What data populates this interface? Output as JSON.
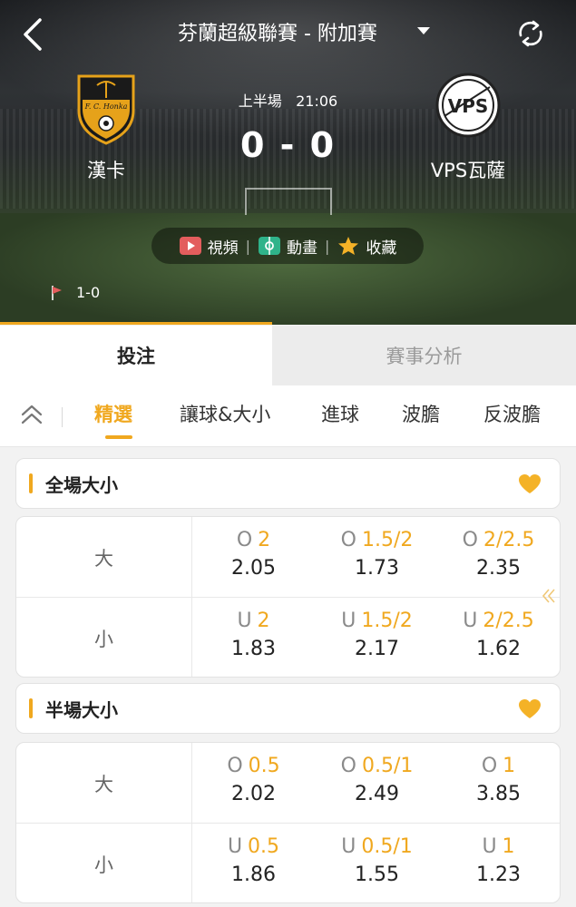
{
  "header": {
    "title": "芬蘭超級聯賽 - 附加賽",
    "back_icon": "chevron-left-icon",
    "refresh_icon": "refresh-icon"
  },
  "match": {
    "home_team": "漢卡",
    "away_team": "VPS瓦薩",
    "period": "上半場",
    "clock": "21:06",
    "score": "0 - 0",
    "home_crest_text": "F. C. Honka",
    "away_crest_text": "VPS",
    "corners": "1-0"
  },
  "actions": [
    {
      "label": "視頻",
      "icon": "video-icon"
    },
    {
      "label": "動畫",
      "icon": "animation-icon"
    },
    {
      "label": "收藏",
      "icon": "star-icon"
    }
  ],
  "main_tabs": [
    {
      "label": "投注",
      "active": true
    },
    {
      "label": "賽事分析",
      "active": false
    }
  ],
  "sub_tabs": [
    {
      "label": "精選",
      "active": true
    },
    {
      "label": "讓球&大小",
      "active": false
    },
    {
      "label": "進球",
      "active": false
    },
    {
      "label": "波膽",
      "active": false
    },
    {
      "label": "反波膽",
      "active": false
    }
  ],
  "sections": [
    {
      "title": "全場大小",
      "rows": [
        {
          "label": "大",
          "cells": [
            {
              "side": "O",
              "line": "2",
              "odds": "2.05"
            },
            {
              "side": "O",
              "line": "1.5/2",
              "odds": "1.73"
            },
            {
              "side": "O",
              "line": "2/2.5",
              "odds": "2.35"
            }
          ]
        },
        {
          "label": "小",
          "cells": [
            {
              "side": "U",
              "line": "2",
              "odds": "1.83"
            },
            {
              "side": "U",
              "line": "1.5/2",
              "odds": "2.17"
            },
            {
              "side": "U",
              "line": "2/2.5",
              "odds": "1.62"
            }
          ]
        }
      ]
    },
    {
      "title": "半場大小",
      "rows": [
        {
          "label": "大",
          "cells": [
            {
              "side": "O",
              "line": "0.5",
              "odds": "2.02"
            },
            {
              "side": "O",
              "line": "0.5/1",
              "odds": "2.49"
            },
            {
              "side": "O",
              "line": "1",
              "odds": "3.85"
            }
          ]
        },
        {
          "label": "小",
          "cells": [
            {
              "side": "U",
              "line": "0.5",
              "odds": "1.86"
            },
            {
              "side": "U",
              "line": "0.5/1",
              "odds": "1.55"
            },
            {
              "side": "U",
              "line": "1",
              "odds": "1.23"
            }
          ]
        }
      ]
    }
  ],
  "colors": {
    "accent": "#f0a81f",
    "video_icon": "#e35d5d",
    "animation_icon": "#2fb38a",
    "star_icon": "#f4b227"
  }
}
